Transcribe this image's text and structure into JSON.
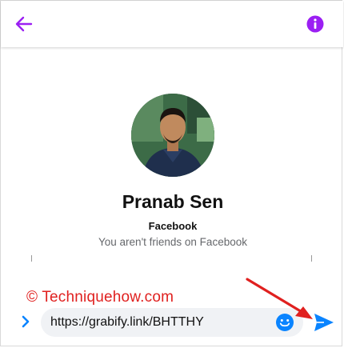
{
  "header": {
    "back_icon": "arrow-left-icon",
    "info_icon": "info-icon",
    "accent_color": "#9b1ff3"
  },
  "profile": {
    "name": "Pranab Sen",
    "platform": "Facebook",
    "friend_status": "You aren't friends on Facebook"
  },
  "watermark": {
    "text": "© Techniquehow.com",
    "color": "#e0201f"
  },
  "composer": {
    "expand_icon": "chevron-right-icon",
    "input_value": "https://grabify.link/BHTTHY",
    "emoji_icon": "smiley-icon",
    "send_icon": "send-icon",
    "accent_color": "#0a84ff"
  }
}
